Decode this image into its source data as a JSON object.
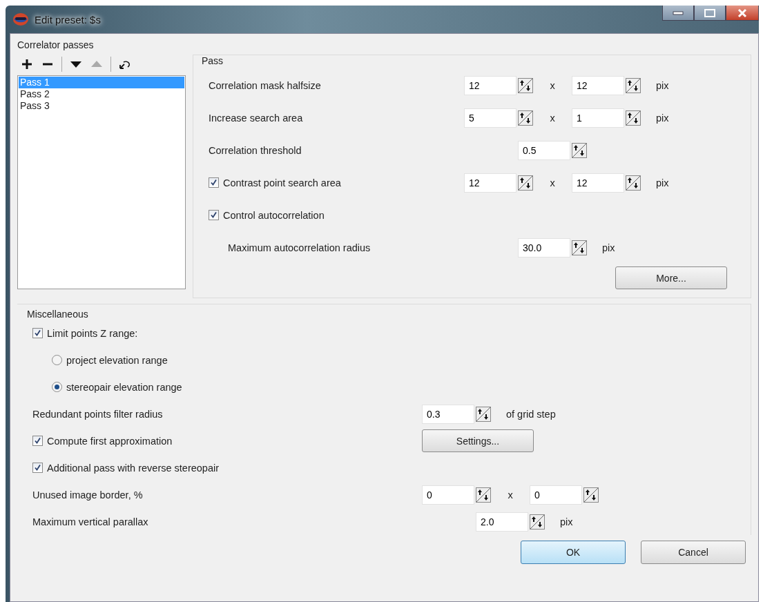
{
  "window": {
    "title": "Edit preset: $s"
  },
  "passes": {
    "title": "Correlator passes",
    "toolbar": [
      {
        "kind": "add",
        "disabled": false
      },
      {
        "kind": "remove",
        "disabled": false
      },
      {
        "kind": "separator"
      },
      {
        "kind": "move_down",
        "disabled": false
      },
      {
        "kind": "move_up",
        "disabled": true
      },
      {
        "kind": "separator"
      },
      {
        "kind": "reset",
        "disabled": false
      }
    ],
    "items": [
      {
        "label": "Pass 1",
        "selected": true
      },
      {
        "label": "Pass 2",
        "selected": false
      },
      {
        "label": "Pass 3",
        "selected": false
      }
    ]
  },
  "pass": {
    "title": "Pass",
    "rows": [
      {
        "kind": "spin_pair",
        "label": "Correlation mask halfsize",
        "values": [
          "12",
          "12"
        ],
        "times": "x",
        "unit": "pix"
      },
      {
        "kind": "spin_pair",
        "label": "Increase search area",
        "values": [
          "5",
          "1"
        ],
        "times": "x",
        "unit": "pix"
      },
      {
        "kind": "spin_centered",
        "label": "Correlation threshold",
        "values": [
          "0.5"
        ]
      },
      {
        "kind": "spin_pair",
        "label": "Contrast point search area",
        "checked": true,
        "values": [
          "12",
          "12"
        ],
        "times": "x",
        "unit": "pix"
      },
      {
        "kind": "option",
        "label": "Control autocorrelation",
        "checked": true,
        "children": [
          {
            "kind": "spin_centered",
            "label": "Maximum autocorrelation radius",
            "values": [
              "30.0"
            ],
            "unit": "pix"
          }
        ]
      }
    ],
    "more_button": "More..."
  },
  "misc": {
    "title": "Miscellaneous",
    "rows": [
      {
        "kind": "option",
        "label": "Limit points Z range:",
        "checked": true,
        "children": [
          {
            "kind": "radio",
            "label": "project elevation range",
            "selected": false
          },
          {
            "kind": "radio",
            "label": "stereopair elevation range",
            "selected": true
          }
        ]
      },
      {
        "kind": "spin_single",
        "label": "Redundant points filter radius",
        "values": [
          "0.3"
        ],
        "unit": "of grid step"
      },
      {
        "kind": "button",
        "label": "Compute first approximation",
        "checked": true,
        "button": "Settings..."
      },
      {
        "kind": "option",
        "label": "Additional pass with reverse stereopair",
        "checked": true
      },
      {
        "kind": "spin_pair",
        "label": "Unused image border, %",
        "values": [
          "0",
          "0"
        ],
        "times": "x"
      },
      {
        "kind": "spin_centered",
        "label": "Maximum vertical parallax",
        "values": [
          "2.0"
        ],
        "unit": "pix"
      }
    ]
  },
  "buttons": [
    {
      "label": "OK",
      "default": true
    },
    {
      "label": "Cancel",
      "default": false
    }
  ]
}
